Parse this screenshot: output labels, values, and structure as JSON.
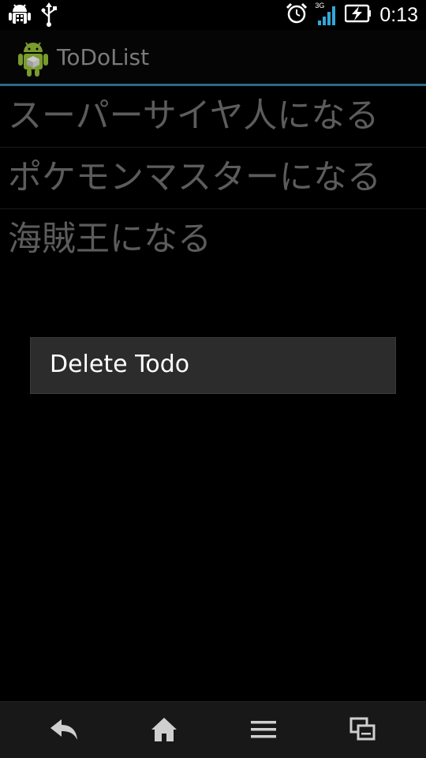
{
  "status_bar": {
    "time": "0:13",
    "network_type": "3G",
    "icons": [
      "android-debug-icon",
      "usb-icon",
      "alarm-icon",
      "signal-icon",
      "battery-charging-icon"
    ]
  },
  "action_bar": {
    "title": "ToDoList",
    "icon": "android-app-icon"
  },
  "todos": [
    "スーパーサイヤ人になる",
    "ポケモンマスターになる",
    "海賊王になる"
  ],
  "context_menu": {
    "items": [
      "Delete Todo"
    ]
  },
  "nav_bar": {
    "icons": [
      "back-icon",
      "home-icon",
      "menu-icon",
      "recent-apps-icon"
    ]
  },
  "colors": {
    "accent": "#2b6a87",
    "todo_text": "#5c5c5c",
    "menu_bg": "#2c2c2c"
  }
}
